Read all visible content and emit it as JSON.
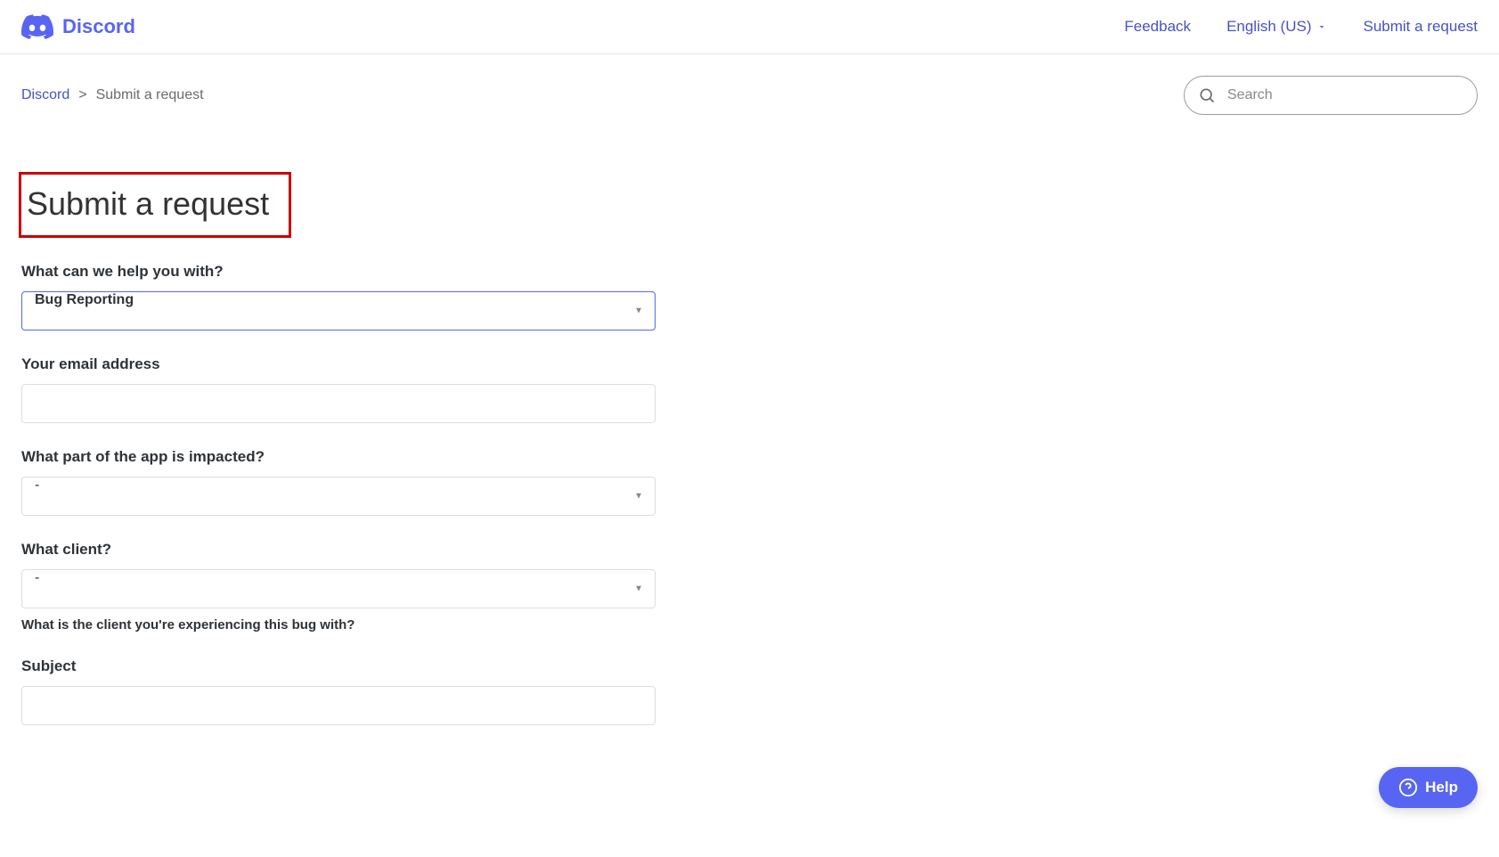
{
  "header": {
    "brand": "Discord",
    "nav": {
      "feedback": "Feedback",
      "language": "English (US)",
      "submit": "Submit a request"
    }
  },
  "breadcrumb": {
    "root": "Discord",
    "separator": ">",
    "current": "Submit a request"
  },
  "search": {
    "placeholder": "Search"
  },
  "page": {
    "title": "Submit a request"
  },
  "form": {
    "help_with": {
      "label": "What can we help you with?",
      "value": "Bug Reporting"
    },
    "email": {
      "label": "Your email address",
      "value": ""
    },
    "app_part": {
      "label": "What part of the app is impacted?",
      "value": "-"
    },
    "client": {
      "label": "What client?",
      "value": "-",
      "hint": "What is the client you're experiencing this bug with?"
    },
    "subject": {
      "label": "Subject",
      "value": ""
    }
  },
  "help_widget": {
    "label": "Help"
  }
}
